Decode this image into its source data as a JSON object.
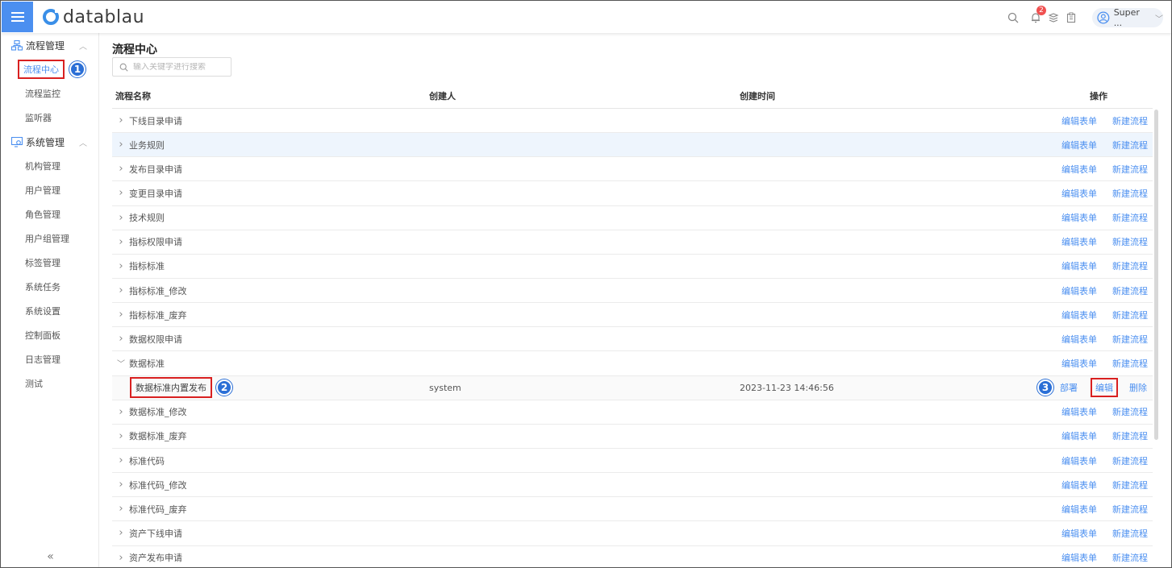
{
  "app": {
    "logo_text": "datablau",
    "notification_count": "2",
    "user_name": "Super ...",
    "accent_color": "#4b8ff0",
    "highlight_color": "#d92020"
  },
  "sidebar": {
    "groups": [
      {
        "label": "流程管理",
        "icon": "workflow-icon",
        "items": [
          "流程中心",
          "流程监控",
          "监听器"
        ]
      },
      {
        "label": "系统管理",
        "icon": "system-settings-icon",
        "items": [
          "机构管理",
          "用户管理",
          "角色管理",
          "用户组管理",
          "标签管理",
          "系统任务",
          "系统设置",
          "控制面板",
          "日志管理",
          "测试"
        ]
      }
    ],
    "collapse_label": "«"
  },
  "main": {
    "title": "流程中心",
    "search_placeholder": "输入关键字进行搜索",
    "columns": {
      "name": "流程名称",
      "creator": "创建人",
      "time": "创建时间",
      "ops": "操作"
    },
    "row_ops": {
      "edit_form": "编辑表单",
      "new_flow": "新建流程"
    },
    "rows": [
      "下线目录申请",
      "业务规则",
      "发布目录申请",
      "变更目录申请",
      "技术规则",
      "指标权限申请",
      "指标标准",
      "指标标准_修改",
      "指标标准_废弃",
      "数据权限申请",
      "数据标准"
    ],
    "child_row": {
      "name": "数据标准内置发布",
      "creator": "system",
      "time": "2023-11-23 14:46:56",
      "ops": {
        "deploy": "部署",
        "edit": "编辑",
        "delete": "删除"
      }
    },
    "rows_after": [
      "数据标准_修改",
      "数据标准_废弃",
      "标准代码",
      "标准代码_修改",
      "标准代码_废弃",
      "资产下线申请",
      "资产发布申请"
    ]
  },
  "markers": {
    "m1": "1",
    "m2": "2",
    "m3": "3"
  }
}
